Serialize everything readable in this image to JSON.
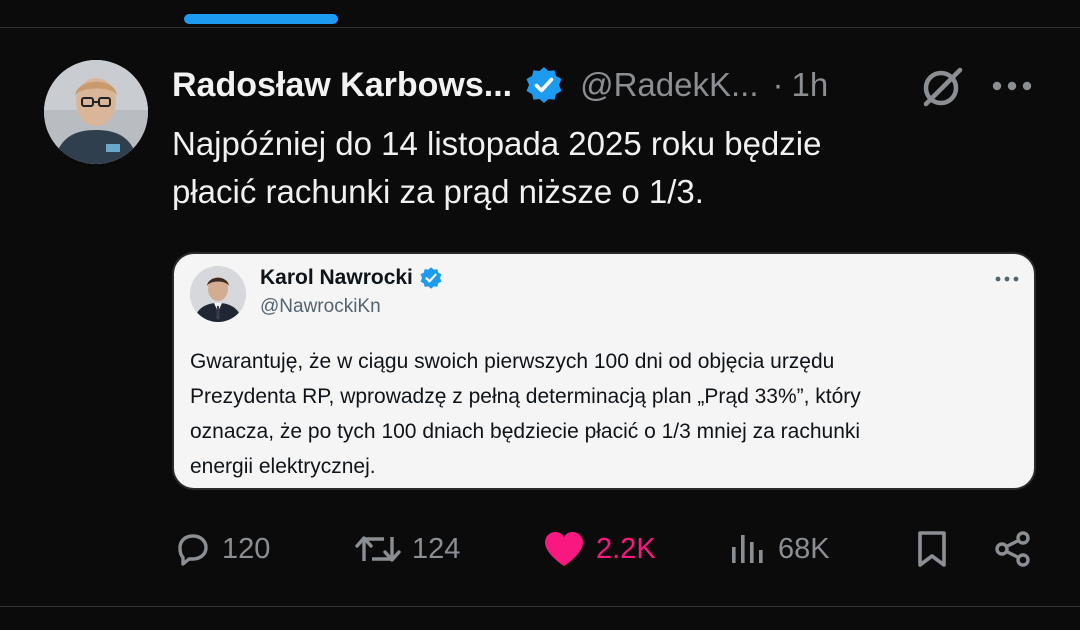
{
  "post": {
    "author_name": "Radosław Karbows...",
    "handle": "@RadekK...",
    "separator": "·",
    "time": "1h",
    "text_lines": [
      "Najpóźniej do 14 listopada 2025 roku będzie",
      "płacić rachunki za prąd niższe o 1/3."
    ]
  },
  "quote": {
    "author_name": "Karol Nawrocki",
    "handle": "@NawrockiKn",
    "text_lines": [
      "Gwarantuję, że w ciągu swoich pierwszych 100 dni od objęcia urzędu",
      "Prezydenta RP, wprowadzę z pełną determinacją plan „Prąd 33%”, który",
      "oznacza, że po tych 100 dniach będziecie płacić o 1/3 mniej za rachunki",
      "energii elektrycznej."
    ]
  },
  "actions": {
    "replies": "120",
    "reposts": "124",
    "likes": "2.2K",
    "views": "68K"
  },
  "icons": {
    "verified": "verified-badge-icon",
    "grok": "grok-icon",
    "more": "more-icon",
    "reply": "reply-icon",
    "repost": "repost-icon",
    "like": "heart-icon",
    "views": "views-icon",
    "bookmark": "bookmark-icon",
    "share": "share-icon"
  },
  "colors": {
    "accent": "#1d9bf0",
    "like": "#f91880",
    "background": "#0b0b0b",
    "muted": "#8b8f93"
  }
}
